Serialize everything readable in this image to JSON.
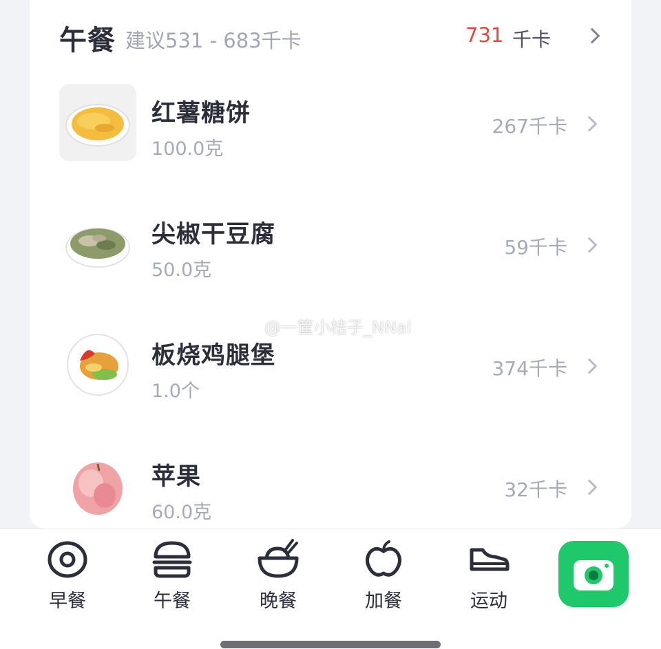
{
  "meal": {
    "title": "午餐",
    "suggestion": "建议531 - 683千卡",
    "total_kcal": "731",
    "kcal_unit": "千卡"
  },
  "foods": [
    {
      "name": "红薯糖饼",
      "amount": "100.0克",
      "kcal": "267千卡"
    },
    {
      "name": "尖椒干豆腐",
      "amount": "50.0克",
      "kcal": "59千卡"
    },
    {
      "name": "板烧鸡腿堡",
      "amount": "1.0个",
      "kcal": "374千卡"
    },
    {
      "name": "苹果",
      "amount": "60.0克",
      "kcal": "32千卡"
    }
  ],
  "watermark": "@一筐小桔子_NNal",
  "tabs": [
    {
      "label": "早餐",
      "icon": "egg-icon"
    },
    {
      "label": "午餐",
      "icon": "burger-icon"
    },
    {
      "label": "晚餐",
      "icon": "bowl-icon"
    },
    {
      "label": "加餐",
      "icon": "apple-icon"
    },
    {
      "label": "运动",
      "icon": "sneaker-icon"
    }
  ],
  "camera": {
    "icon": "camera-icon"
  },
  "colors": {
    "accent_red": "#e24a3b",
    "camera_green": "#1fc86a",
    "text_dark": "#2c2f3a",
    "text_muted": "#a6aab6"
  }
}
